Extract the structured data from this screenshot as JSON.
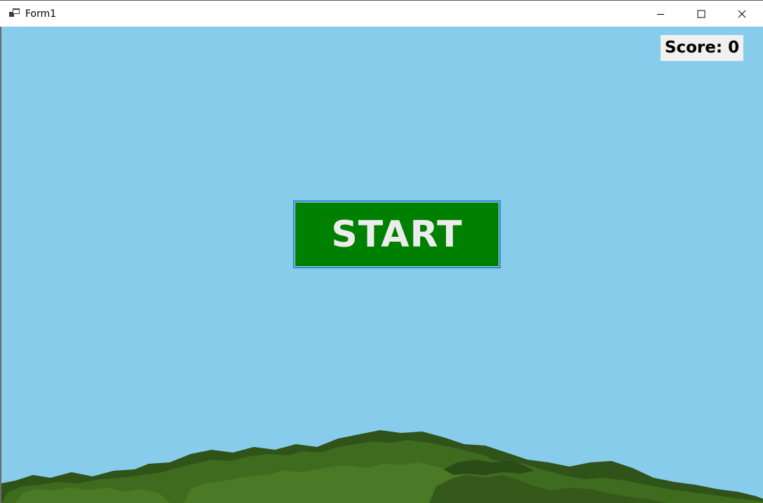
{
  "window": {
    "title": "Form1",
    "icon": "app-window-icon",
    "controls": {
      "minimize_icon": "minimize-icon",
      "maximize_icon": "maximize-icon",
      "close_icon": "close-icon"
    }
  },
  "game": {
    "score_text": "Score: 0",
    "start_label": "START"
  },
  "colors": {
    "sky": "#87cceb",
    "start_button": "#008000",
    "start_text": "#ececec",
    "score_background": "#f0f0f0",
    "bush_dark": "#2f5318",
    "bush_mid": "#3f6b1f",
    "bush_light": "#4a7a25"
  }
}
